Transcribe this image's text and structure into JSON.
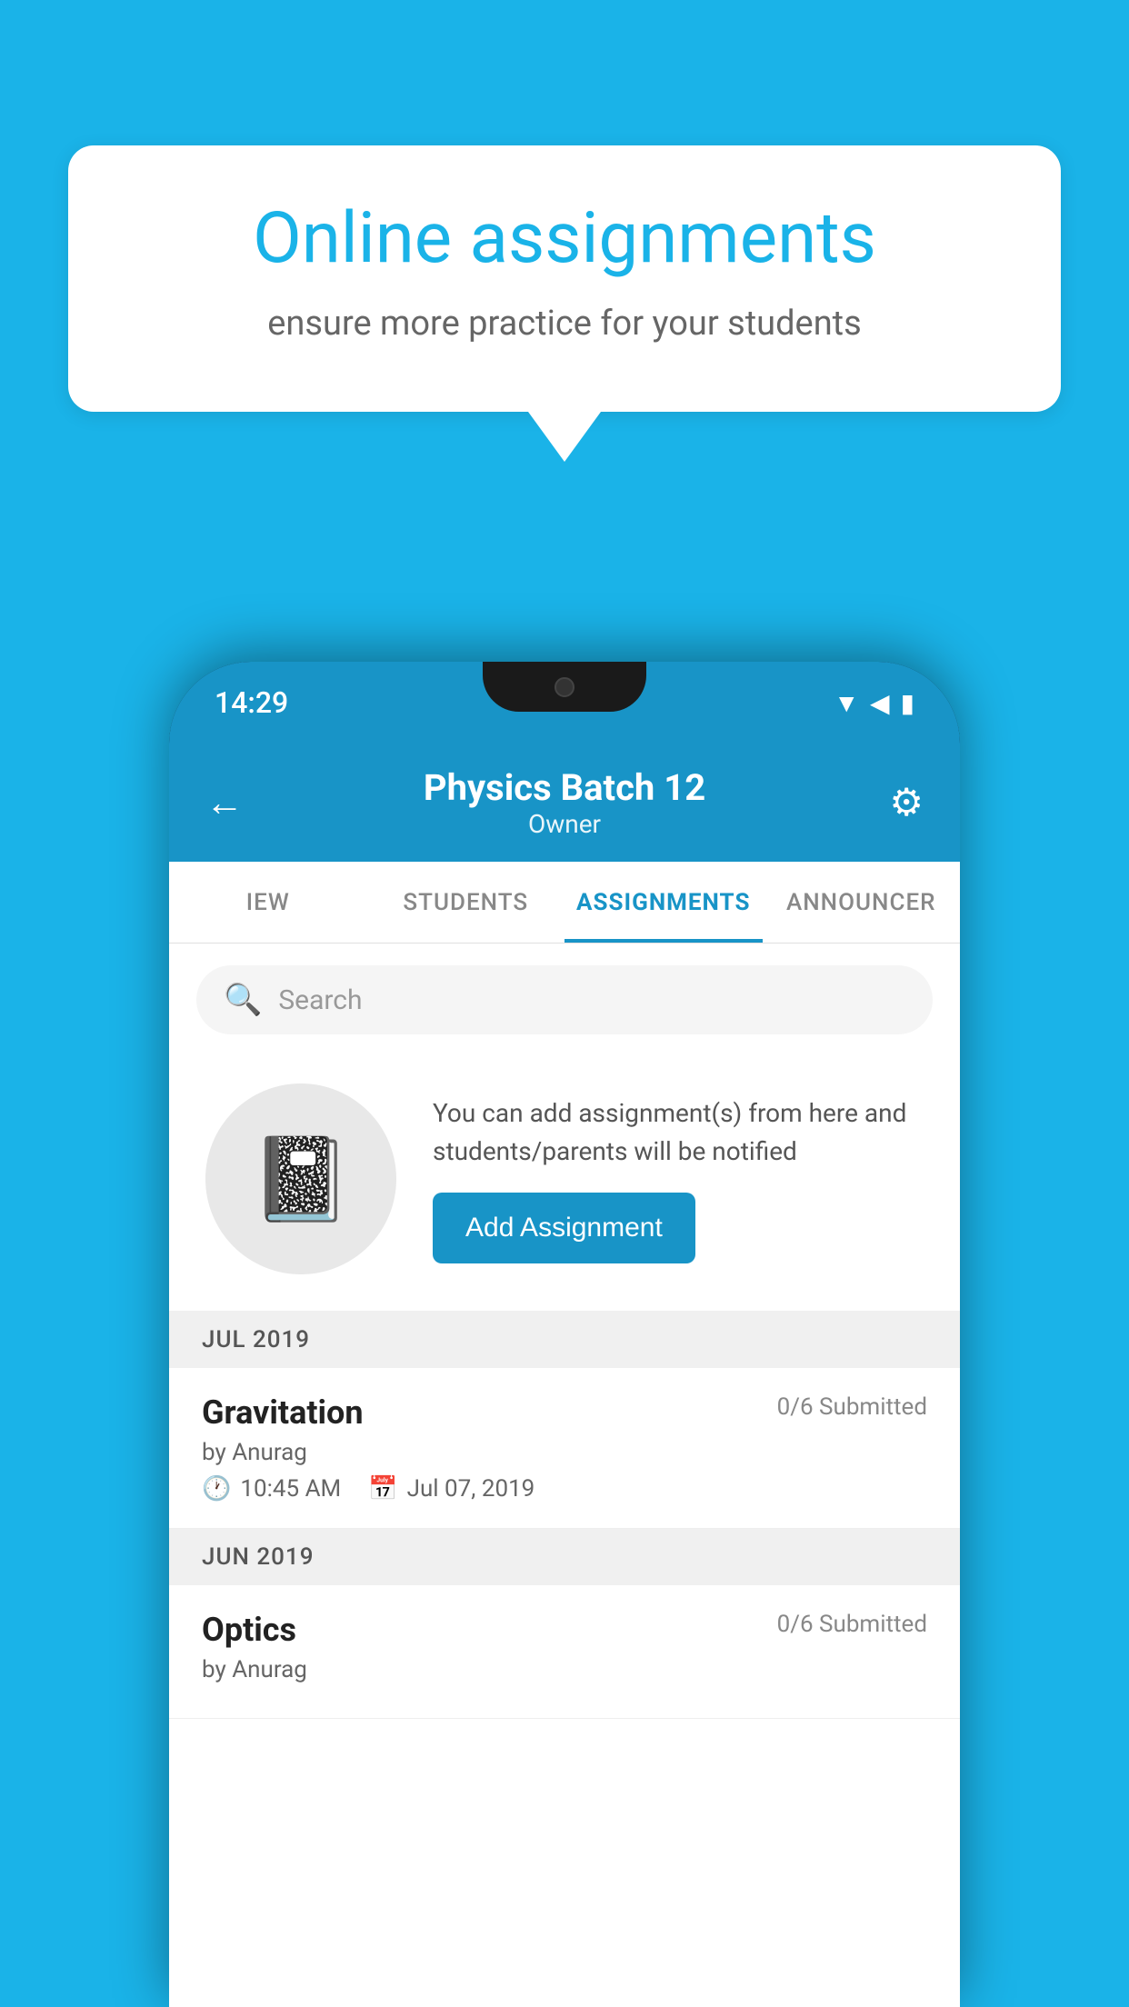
{
  "background_color": "#1ab3e8",
  "speech_bubble": {
    "title": "Online assignments",
    "subtitle": "ensure more practice for your students"
  },
  "phone": {
    "time": "14:29",
    "header": {
      "title": "Physics Batch 12",
      "subtitle": "Owner",
      "back_label": "←",
      "settings_label": "⚙"
    },
    "tabs": [
      {
        "label": "IEW",
        "active": false
      },
      {
        "label": "STUDENTS",
        "active": false
      },
      {
        "label": "ASSIGNMENTS",
        "active": true
      },
      {
        "label": "ANNOUNCER",
        "active": false
      }
    ],
    "search": {
      "placeholder": "Search"
    },
    "add_assignment": {
      "info_text": "You can add assignment(s) from here and students/parents will be notified",
      "button_label": "Add Assignment"
    },
    "sections": [
      {
        "header": "JUL 2019",
        "items": [
          {
            "name": "Gravitation",
            "submitted": "0/6 Submitted",
            "by": "by Anurag",
            "time": "10:45 AM",
            "date": "Jul 07, 2019"
          }
        ]
      },
      {
        "header": "JUN 2019",
        "items": [
          {
            "name": "Optics",
            "submitted": "0/6 Submitted",
            "by": "by Anurag",
            "time": "",
            "date": ""
          }
        ]
      }
    ]
  }
}
